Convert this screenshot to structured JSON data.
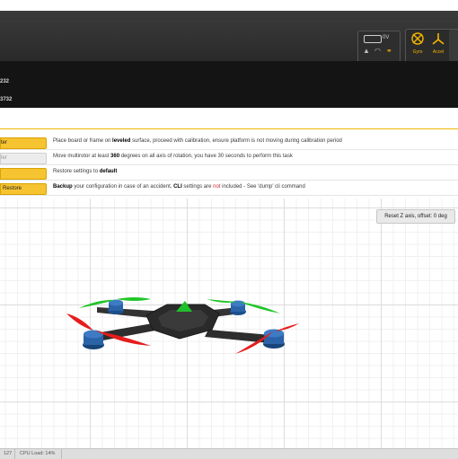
{
  "header": {
    "battery_voltage": "0V",
    "sensors": [
      {
        "label": "Gyro",
        "icon": "gyro-icon"
      },
      {
        "label": "Accel",
        "icon": "accel-icon"
      }
    ],
    "status_icons": [
      "warning-icon",
      "wifi-icon",
      "link-icon"
    ]
  },
  "subheader": {
    "line1": "232",
    "line2": "3732"
  },
  "actions": [
    {
      "label": "ter",
      "description_parts": [
        "Place board or frame on ",
        "leveled",
        " surface, proceed with calibration, ensure platform is not moving during calibration period"
      ],
      "style": "yellow"
    },
    {
      "label": "ter",
      "description_parts": [
        "Move multirotor at least ",
        "360",
        " degrees on all axis of rotation, you have 30 seconds to perform this task"
      ],
      "style": "disabled"
    },
    {
      "label": "",
      "description_parts": [
        "Restore settings to ",
        "default",
        ""
      ],
      "style": "yellow"
    },
    {
      "label": "Restore",
      "description_parts": [
        "Backup",
        " your configuration in case of an accident, ",
        "CLI",
        " settings are ",
        "not",
        " included - See 'dump' cli command"
      ],
      "style": "yellow"
    }
  ],
  "viewport": {
    "reset_label": "Reset Z axis, offset: 0 deg",
    "colors": {
      "frame": "#2d2d2d",
      "prop_front": "#22c52a",
      "prop_rear": "#e61c1c",
      "motor": "#2b63a8"
    }
  },
  "statusbar": {
    "left_value": "127",
    "cpu_load": "CPU Load: 14%"
  }
}
